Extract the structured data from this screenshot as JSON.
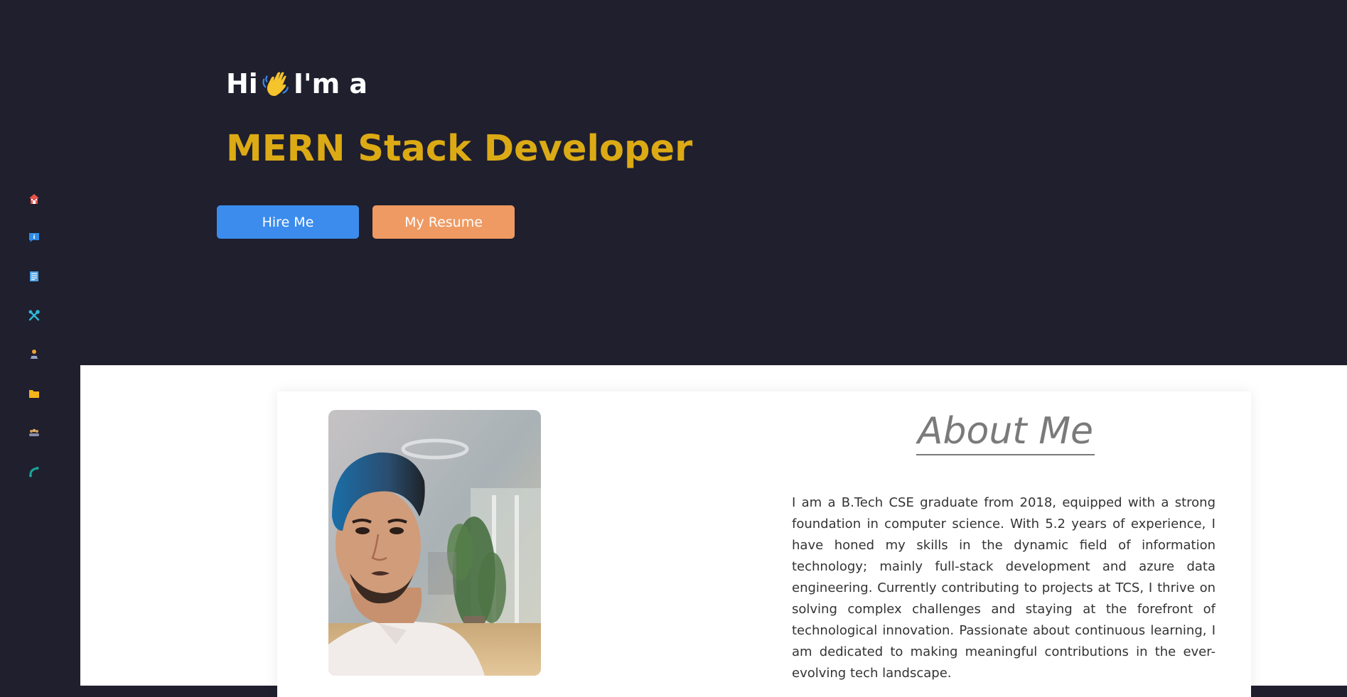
{
  "sidebar": {
    "items": [
      {
        "name": "home",
        "icon": "home-icon",
        "color": "#e8534a"
      },
      {
        "name": "about",
        "icon": "info-chat-icon",
        "color": "#2f8be8"
      },
      {
        "name": "resume",
        "icon": "document-icon",
        "color": "#4ca3e6"
      },
      {
        "name": "skills",
        "icon": "tools-icon",
        "color": "#2fb8d9"
      },
      {
        "name": "experience",
        "icon": "person-laptop-icon",
        "color": "#6a6ae0"
      },
      {
        "name": "projects",
        "icon": "folder-icon",
        "color": "#f5b41a"
      },
      {
        "name": "team",
        "icon": "people-icon",
        "color": "#d9a050"
      },
      {
        "name": "contact",
        "icon": "phone-icon",
        "color": "#17a39a"
      }
    ]
  },
  "hero": {
    "greeting_pre": "Hi",
    "greeting_post": "I'm a",
    "role": "MERN Stack Developer",
    "hire_label": "Hire Me",
    "resume_label": "My Resume",
    "role_color": "#dcaa14",
    "hire_color": "#3b8ced",
    "resume_color": "#ef9a62"
  },
  "about": {
    "title": "About Me",
    "text": "I am a B.Tech CSE graduate from 2018, equipped with a strong foundation in computer science. With 5.2 years of experience, I have honed my skills in the dynamic field of information technology; mainly full-stack development and azure data engineering. Currently contributing to projects at TCS, I thrive on solving complex challenges and staying at the forefront of technological innovation. Passionate about continuous learning, I am dedicated to making meaningful contributions in the ever-evolving tech landscape."
  }
}
